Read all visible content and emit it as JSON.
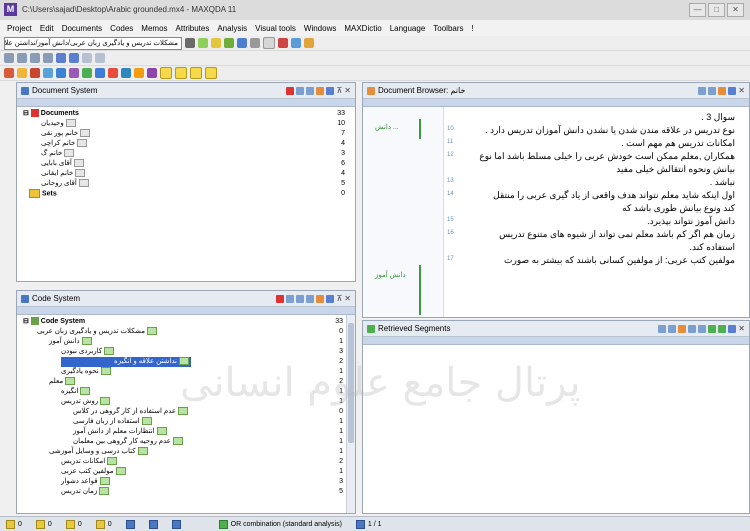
{
  "window": {
    "title": "C:\\Users\\sajad\\Desktop\\Arabic grounded.mx4 - MAXQDA 11",
    "min": "—",
    "max": "□",
    "close": "✕"
  },
  "menu": [
    "Project",
    "Edit",
    "Documents",
    "Codes",
    "Memos",
    "Attributes",
    "Analysis",
    "Visual tools",
    "Windows",
    "MAXDictio",
    "Language",
    "Toolbars",
    "!"
  ],
  "toolbar1": {
    "combo_text": "مشکلات تدریس و یادگیری زبان عربی/دانش آموز/نداشتن علاقه و انگیزه"
  },
  "document_system": {
    "title": "Document System",
    "root": {
      "label": "Documents",
      "count": "33"
    },
    "root_sub_count": "10",
    "items": [
      {
        "label": "وحیدیان",
        "count": ""
      },
      {
        "label": "خانم پور نقی",
        "count": "7"
      },
      {
        "label": "خانم کراچی",
        "count": "4"
      },
      {
        "label": "خانم گ",
        "count": "3"
      },
      {
        "label": "آقای بابایی",
        "count": "6"
      },
      {
        "label": "خانم ایقانی",
        "count": "4"
      },
      {
        "label": "آقای روحانی",
        "count": "5"
      }
    ],
    "sets": {
      "label": "Sets",
      "count": "0"
    }
  },
  "document_browser": {
    "title": "Document Browser: خانم",
    "lines": [
      {
        "n": "",
        "text": "سوال 3 ."
      },
      {
        "n": "10",
        "text": "نوع تدریس در علاقه مندن شدن یا نشدن دانش آموزان تدریس دارد ."
      },
      {
        "n": "11",
        "text": "امکانات تدریس هم مهم است ."
      },
      {
        "n": "12",
        "text": "همکاران ,معلم ممکن است خودش عربی را خیلی مسلط باشد اما نوع"
      },
      {
        "n": "",
        "text": "بیانش ونحوه انتقالش خیلی مفید"
      },
      {
        "n": "13",
        "text": "نباشد ."
      },
      {
        "n": "14",
        "text": "اول اینکه شاید معلم نتواند هدف واقعی از یاد گیری عربی را منتقل"
      },
      {
        "n": "",
        "text": "کند ونوع بیانش طوری باشد که"
      },
      {
        "n": "15",
        "text": "دانش آموز نتواند بپذیرد."
      },
      {
        "n": "16",
        "text": "زمان هم اگر کم باشد معلم نمی تواند از شیوه های متنوع تدریس"
      },
      {
        "n": "",
        "text": "استفاده کند."
      },
      {
        "n": "17",
        "text": "مولفین کتب عربی: از مولفین کسانی باشند که بیشتر به صورت"
      }
    ],
    "code_tag_1": "دانش ...",
    "code_tag_2": "دانش آموز"
  },
  "code_system": {
    "title": "Code System",
    "root": {
      "label": "Code System",
      "count": "33"
    },
    "items": [
      {
        "label": "مشکلات تدریس و یادگیری زبان عربی",
        "count": "0",
        "indent": 1
      },
      {
        "label": "دانش آموز",
        "count": "1",
        "indent": 2
      },
      {
        "label": "کاربردی نبودن",
        "count": "3",
        "indent": 3
      },
      {
        "label": "نداشتن علاقه و انگیزه",
        "count": "2",
        "indent": 3,
        "selected": true
      },
      {
        "label": "نحوه یادگیری",
        "count": "1",
        "indent": 3
      },
      {
        "label": "معلم",
        "count": "2",
        "indent": 2
      },
      {
        "label": "انگیزه",
        "count": "1",
        "indent": 3
      },
      {
        "label": "روش تدریس",
        "count": "1",
        "indent": 3
      },
      {
        "label": "عدم استفاده از کار گروهی در کلاس",
        "count": "0",
        "indent": 4
      },
      {
        "label": "استفاده از زبان فارسی",
        "count": "1",
        "indent": 4
      },
      {
        "label": "انتظارات معلم از دانش آموز",
        "count": "1",
        "indent": 4
      },
      {
        "label": "عدم روحیه کار گروهی بین معلمان",
        "count": "1",
        "indent": 4
      },
      {
        "label": "کتاب درسی و وسایل آموزشی",
        "count": "1",
        "indent": 2
      },
      {
        "label": "امکانات تدریس",
        "count": "2",
        "indent": 3
      },
      {
        "label": "مولفین کتب عربی",
        "count": "1",
        "indent": 3
      },
      {
        "label": "قواعد دشوار",
        "count": "3",
        "indent": 3
      },
      {
        "label": "زمان تدریس",
        "count": "5",
        "indent": 3
      }
    ]
  },
  "retrieved_segments": {
    "title": "Retrieved Segments"
  },
  "status": [
    {
      "icon": "document-icon",
      "value": "0"
    },
    {
      "icon": "code-icon",
      "value": "0"
    },
    {
      "icon": "segment-icon",
      "value": "0"
    },
    {
      "icon": "memo-icon",
      "value": "0"
    },
    {
      "icon": "weight-icon",
      "value": ""
    },
    {
      "icon": "attribute-icon",
      "value": ""
    },
    {
      "icon": "set-icon",
      "value": ""
    }
  ],
  "status_mode": "OR combination (standard analysis)",
  "status_pages": "1 / 1",
  "watermark": "پرتال جامع علوم انسانی"
}
